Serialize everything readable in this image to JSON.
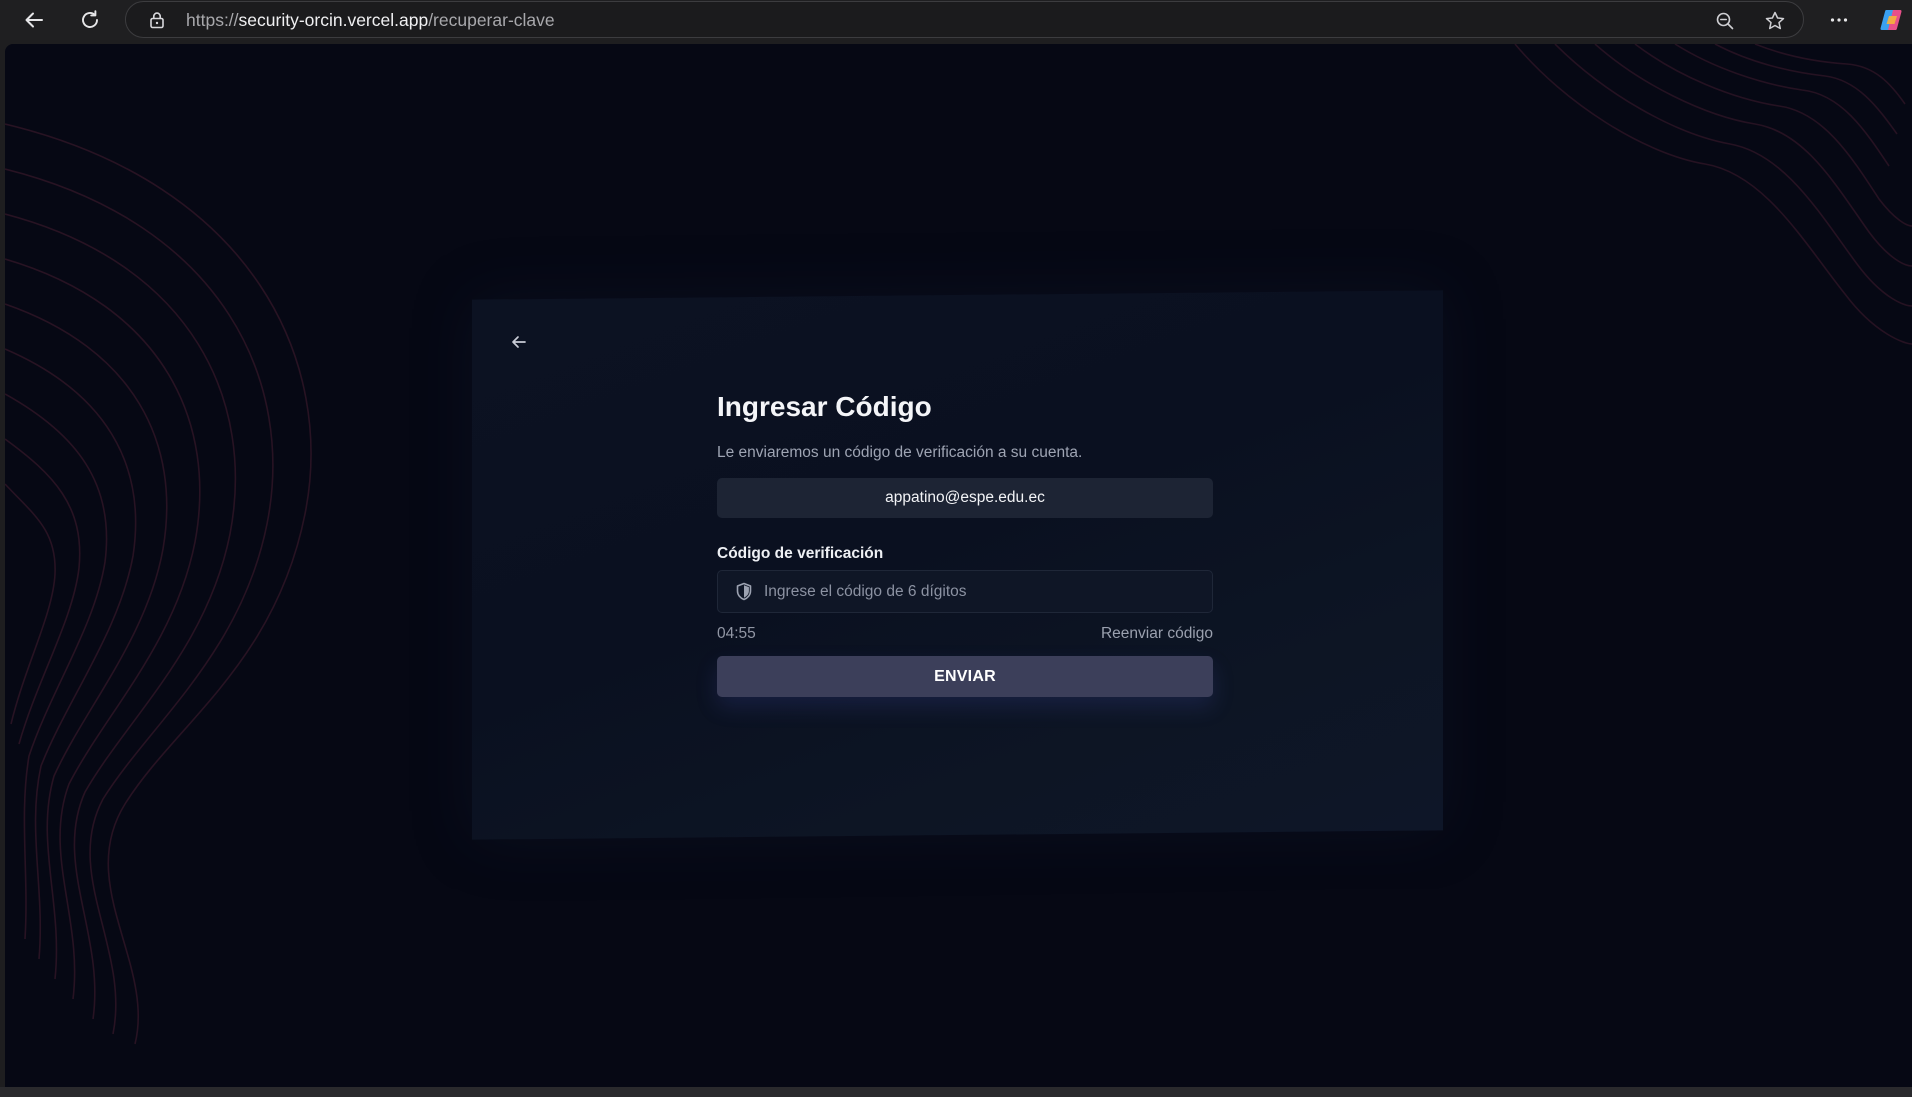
{
  "browser": {
    "url_scheme": "https://",
    "url_host": "security-orcin.vercel.app",
    "url_path": "/recuperar-clave",
    "icons": [
      "back-icon",
      "refresh-icon",
      "lock-icon",
      "zoom-out-icon",
      "star-icon",
      "more-icon",
      "copilot-icon"
    ]
  },
  "page": {
    "title": "Ingresar Código",
    "subtitle": "Le enviaremos un código de verificación a su cuenta.",
    "email": "appatino@espe.edu.ec",
    "code_label": "Código de verificación",
    "code_placeholder": "Ingrese el código de 6 dígitos",
    "code_value": "",
    "timer": "04:55",
    "resend_label": "Reenviar código",
    "submit_label": "ENVIAR"
  },
  "colors": {
    "background": "#060814",
    "card": "#0c1222",
    "button": "#3c3f5a",
    "contour_lines": "#2a1424"
  }
}
